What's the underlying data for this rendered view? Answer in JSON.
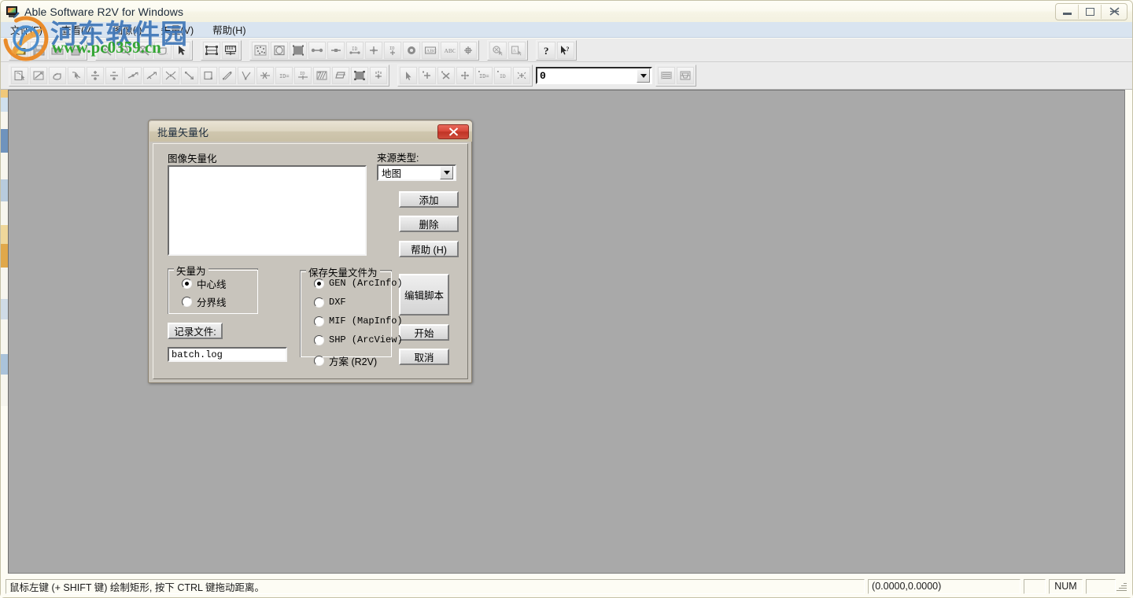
{
  "window": {
    "title": "Able Software R2V for Windows",
    "icon": "app-monitor-icon",
    "controls": {
      "minimize": "—",
      "maximize": "□",
      "close": "✕"
    }
  },
  "menu": {
    "items": [
      {
        "label": "文件(F)"
      },
      {
        "label": "查看(V)"
      },
      {
        "label": "图像(I)"
      },
      {
        "label": "矢量(V)"
      },
      {
        "label": "帮助(H)"
      }
    ]
  },
  "toolbar_top": {
    "groups": [
      {
        "buttons": [
          {
            "icon": "open-folder-icon",
            "enabled": true
          },
          {
            "icon": "save-disk-icon",
            "enabled": false
          },
          {
            "icon": "import-image-icon",
            "enabled": false
          },
          {
            "icon": "save-image-icon",
            "enabled": false
          }
        ]
      },
      {
        "buttons": [
          {
            "icon": "zoom-in-icon",
            "enabled": false
          },
          {
            "icon": "zoom-out-icon",
            "enabled": false
          },
          {
            "icon": "zoom-fit-icon",
            "enabled": false
          },
          {
            "icon": "pan-hand-icon",
            "enabled": false
          },
          {
            "icon": "arrow-select-icon",
            "enabled": true
          }
        ]
      },
      {
        "buttons": [
          {
            "icon": "image-crop-icon",
            "enabled": true
          },
          {
            "icon": "image-register-icon",
            "enabled": true
          }
        ]
      },
      {
        "buttons": [
          {
            "icon": "raster-noise-icon",
            "enabled": false
          },
          {
            "icon": "raster-frame-icon",
            "enabled": false
          },
          {
            "icon": "raster-fill-icon",
            "enabled": false
          },
          {
            "icon": "line-node-icon",
            "enabled": false
          },
          {
            "icon": "line-endpoint-icon",
            "enabled": false
          },
          {
            "icon": "line-id-icon",
            "enabled": false
          },
          {
            "icon": "point-cross-icon",
            "enabled": false
          },
          {
            "icon": "point-id-icon",
            "enabled": false
          },
          {
            "icon": "circle-target-icon",
            "enabled": false
          },
          {
            "icon": "text-abc-boxed-icon",
            "enabled": false
          },
          {
            "icon": "text-abc-icon",
            "enabled": false
          },
          {
            "icon": "node-marker-icon",
            "enabled": false
          }
        ]
      },
      {
        "buttons": [
          {
            "icon": "select-circle-icon",
            "enabled": false
          },
          {
            "icon": "select-text-icon",
            "enabled": false
          }
        ]
      },
      {
        "buttons": [
          {
            "icon": "help-question-icon",
            "enabled": true
          },
          {
            "icon": "help-context-icon",
            "enabled": true
          }
        ]
      }
    ]
  },
  "toolbar_bottom": {
    "groups": [
      {
        "buttons": [
          {
            "icon": "edit-vector-icon",
            "enabled": false
          },
          {
            "icon": "draw-line-icon",
            "enabled": false
          },
          {
            "icon": "trace-hand-icon",
            "enabled": false
          },
          {
            "icon": "follow-line-icon",
            "enabled": false
          },
          {
            "icon": "add-node-icon",
            "enabled": false
          },
          {
            "icon": "delete-node-icon",
            "enabled": false
          },
          {
            "icon": "split-line-icon",
            "enabled": false
          },
          {
            "icon": "join-line-icon",
            "enabled": false
          },
          {
            "icon": "collapse-nodes-icon",
            "enabled": false
          },
          {
            "icon": "move-node-icon",
            "enabled": false
          },
          {
            "icon": "rectangle-icon",
            "enabled": false
          },
          {
            "icon": "parallel-line-icon",
            "enabled": false
          },
          {
            "icon": "angle-line-icon",
            "enabled": false
          },
          {
            "icon": "cut-line-icon",
            "enabled": false
          },
          {
            "icon": "line-id-label-icon",
            "enabled": false
          },
          {
            "icon": "line-attr-icon",
            "enabled": false
          },
          {
            "icon": "hatch-area-icon",
            "enabled": false
          },
          {
            "icon": "polygon-icon",
            "enabled": false
          },
          {
            "icon": "fill-polygon-icon",
            "enabled": false
          },
          {
            "icon": "centroid-icon",
            "enabled": false
          }
        ]
      },
      {
        "buttons": [
          {
            "icon": "pointer-small-icon",
            "enabled": false
          },
          {
            "icon": "add-point-icon",
            "enabled": false
          },
          {
            "icon": "delete-point-icon",
            "enabled": false
          },
          {
            "icon": "move-point-icon",
            "enabled": false
          },
          {
            "icon": "point-id-edit-icon",
            "enabled": false
          },
          {
            "icon": "point-id-show-icon",
            "enabled": false
          },
          {
            "icon": "highlight-point-icon",
            "enabled": false
          }
        ]
      }
    ],
    "layer_combo": {
      "value": "0",
      "icon": "chevron-down-icon"
    },
    "trailing_buttons": [
      {
        "icon": "layers-list-icon",
        "enabled": false
      },
      {
        "icon": "layer-properties-icon",
        "enabled": false
      }
    ]
  },
  "dialog": {
    "title": "批量矢量化",
    "close_glyph": "✕",
    "image_list": {
      "label": "图像矢量化",
      "items": []
    },
    "source_type": {
      "label": "来源类型:",
      "value": "地图",
      "options": [
        "地图"
      ]
    },
    "buttons": {
      "add": "添加",
      "delete": "删除",
      "help": "帮助 (H)",
      "edit_script": "编辑脚本",
      "start": "开始",
      "cancel": "取消",
      "log_file": "记录文件:"
    },
    "vectorize_as": {
      "label": "矢量为",
      "options": [
        {
          "label": "中心线",
          "selected": true
        },
        {
          "label": "分界线",
          "selected": false
        }
      ]
    },
    "save_as": {
      "label": "保存矢量文件为",
      "options": [
        {
          "label": "GEN  (ArcInfo)",
          "selected": true,
          "mono": true
        },
        {
          "label": "DXF",
          "selected": false,
          "mono": true
        },
        {
          "label": "MIF  (MapInfo)",
          "selected": false,
          "mono": true
        },
        {
          "label": "SHP  (ArcView)",
          "selected": false,
          "mono": true
        },
        {
          "label": "方案  (R2V)",
          "selected": false,
          "mono": false
        }
      ]
    },
    "log_file_value": "batch.log"
  },
  "statusbar": {
    "message": "鼠标左键 (+ SHIFT 键) 绘制矩形, 按下 CTRL 键拖动距离。",
    "coordinates": "(0.0000,0.0000)",
    "pane_small": "",
    "num_lock": "NUM",
    "pane_last": ""
  },
  "watermark": {
    "site_name": "河东软件园",
    "url": "www.pc0359.cn",
    "logo": "circle-arrow-logo"
  },
  "colors": {
    "menu_bg": "#d9e4f0",
    "toolbar_bg": "#ebebeb",
    "workarea_bg": "#a9a9a9",
    "dialog_bg": "#c8c4bc",
    "close_btn_red": "#c03425",
    "watermark_blue": "#3f77b8",
    "watermark_green": "#2aa32a"
  }
}
